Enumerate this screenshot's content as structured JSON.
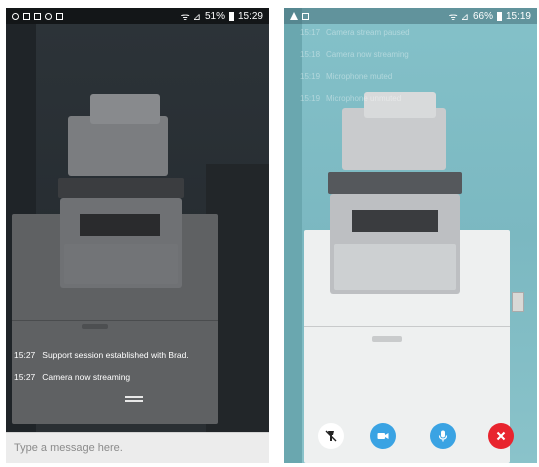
{
  "left_screen": {
    "status_bar": {
      "signal": "ᯤ ⊿",
      "battery": "51%",
      "time": "15:29"
    },
    "messages": [
      {
        "time": "15:27",
        "text": "Support session established with Brad."
      },
      {
        "time": "15:27",
        "text": "Camera now streaming"
      }
    ],
    "message_input": {
      "placeholder": "Type a message here."
    }
  },
  "right_screen": {
    "status_bar": {
      "signal": "ᯤ ⊿",
      "battery": "66%",
      "time": "15:19"
    },
    "log": [
      {
        "time": "15:17",
        "text": "Camera stream paused"
      },
      {
        "time": "15:18",
        "text": "Camera now streaming"
      },
      {
        "time": "15:19",
        "text": "Microphone muted"
      },
      {
        "time": "15:19",
        "text": "Microphone unmuted"
      }
    ],
    "controls": [
      {
        "icon": "flashlight-off-icon",
        "color": "#ffffff"
      },
      {
        "icon": "video-camera-icon",
        "color": "#3aa3e3"
      },
      {
        "icon": "microphone-icon",
        "color": "#3aa3e3"
      },
      {
        "icon": "close-icon",
        "color": "#e8242e"
      }
    ]
  }
}
